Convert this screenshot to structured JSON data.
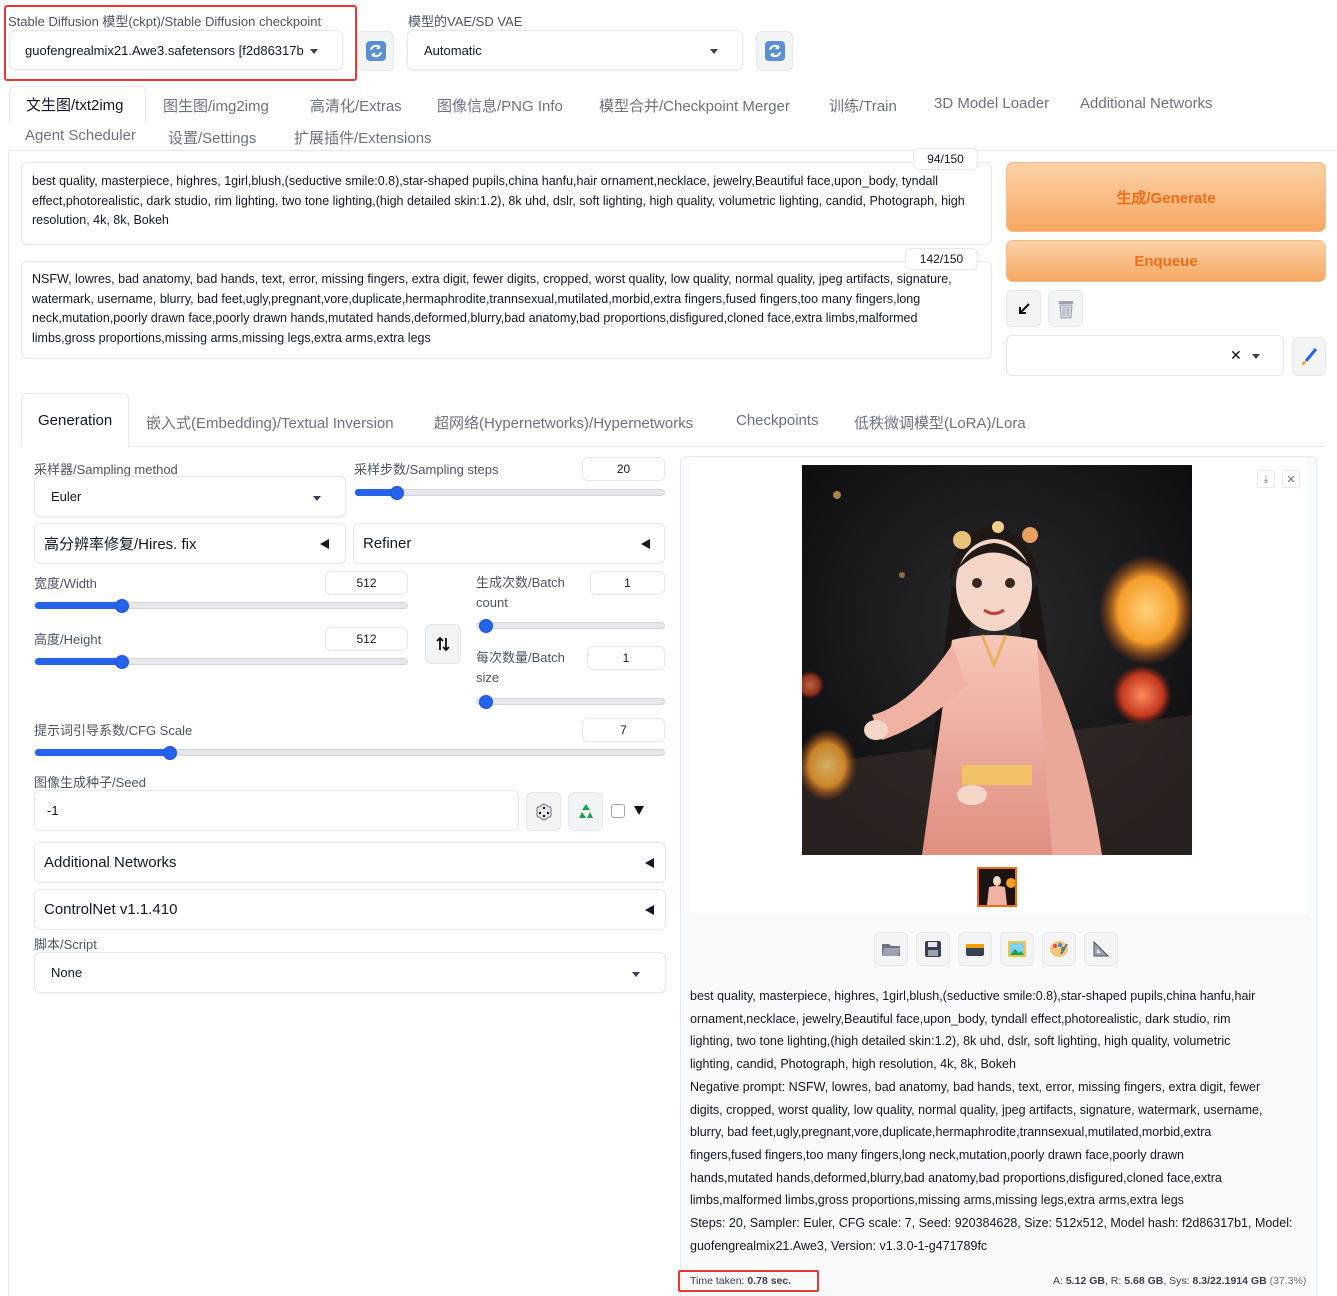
{
  "top": {
    "checkpoint_label": "Stable Diffusion 模型(ckpt)/Stable Diffusion checkpoint",
    "checkpoint_value": "guofengrealmix21.Awe3.safetensors [f2d86317b",
    "vae_label": "模型的VAE/SD VAE",
    "vae_value": "Automatic"
  },
  "tabs_main": [
    "文生图/txt2img",
    "图生图/img2img",
    "高清化/Extras",
    "图像信息/PNG Info",
    "模型合并/Checkpoint Merger",
    "训练/Train",
    "3D Model Loader",
    "Additional Networks",
    "Agent Scheduler",
    "设置/Settings",
    "扩展插件/Extensions"
  ],
  "prompt": {
    "text": "best quality, masterpiece, highres, 1girl,blush,(seductive smile:0.8),star-shaped pupils,china hanfu,hair ornament,necklace, jewelry,Beautiful face,upon_body, tyndall effect,photorealistic, dark studio, rim lighting, two tone lighting,(high detailed skin:1.2), 8k uhd, dslr, soft lighting, high quality, volumetric lighting, candid, Photograph, high resolution, 4k, 8k, Bokeh",
    "count": "94/150"
  },
  "negative": {
    "text": "NSFW, lowres, bad anatomy, bad hands, text, error, missing fingers, extra digit, fewer digits, cropped, worst quality, low quality, normal quality, jpeg artifacts, signature, watermark, username, blurry, bad feet,ugly,pregnant,vore,duplicate,hermaphrodite,trannsexual,mutilated,morbid,extra fingers,fused fingers,too many fingers,long neck,mutation,poorly drawn face,poorly drawn hands,mutated hands,deformed,blurry,bad anatomy,bad proportions,disfigured,cloned face,extra limbs,malformed limbs,gross proportions,missing arms,missing legs,extra arms,extra legs",
    "count": "142/150"
  },
  "actions": {
    "generate": "生成/Generate",
    "enqueue": "Enqueue"
  },
  "subtabs": [
    "Generation",
    "嵌入式(Embedding)/Textual Inversion",
    "超网络(Hypernetworks)/Hypernetworks",
    "Checkpoints",
    "低秩微调模型(LoRA)/Lora"
  ],
  "params": {
    "sampler_label": "采样器/Sampling method",
    "sampler_value": "Euler",
    "steps_label": "采样步数/Sampling steps",
    "steps_value": "20",
    "steps_fraction": 0.137,
    "hires_label": "高分辨率修复/Hires. fix",
    "refiner_label": "Refiner",
    "width_label": "宽度/Width",
    "width_value": "512",
    "width_fraction": 0.235,
    "height_label": "高度/Height",
    "height_value": "512",
    "height_fraction": 0.235,
    "batch_count_label_1": "生成次数/Batch",
    "batch_count_label_2": "count",
    "batch_count_value": "1",
    "batch_size_label_1": "每次数量/Batch",
    "batch_size_label_2": "size",
    "batch_size_value": "1",
    "cfg_label": "提示词引导系数/CFG Scale",
    "cfg_value": "7",
    "cfg_fraction": 0.214,
    "seed_label": "图像生成种子/Seed",
    "seed_value": "-1",
    "additional_networks": "Additional Networks",
    "controlnet": "ControlNet v1.1.410",
    "script_label": "脚本/Script",
    "script_value": "None"
  },
  "output": {
    "info_lines": [
      "best quality, masterpiece, highres, 1girl,blush,(seductive smile:0.8),star-shaped pupils,china hanfu,hair",
      "ornament,necklace, jewelry,Beautiful face,upon_body, tyndall effect,photorealistic, dark studio, rim",
      "lighting, two tone lighting,(high detailed skin:1.2), 8k uhd, dslr, soft lighting, high quality, volumetric",
      "lighting, candid, Photograph, high resolution, 4k, 8k, Bokeh",
      "Negative prompt: NSFW, lowres, bad anatomy, bad hands, text, error, missing fingers, extra digit, fewer",
      "digits, cropped, worst quality, low quality, normal quality, jpeg artifacts, signature, watermark, username,",
      "blurry, bad feet,ugly,pregnant,vore,duplicate,hermaphrodite,trannsexual,mutilated,morbid,extra",
      "fingers,fused fingers,too many fingers,long neck,mutation,poorly drawn face,poorly drawn",
      "hands,mutated hands,deformed,blurry,bad anatomy,bad proportions,disfigured,cloned face,extra",
      "limbs,malformed limbs,gross proportions,missing arms,missing legs,extra arms,extra legs",
      "Steps: 20, Sampler: Euler, CFG scale: 7, Seed: 920384628, Size: 512x512, Model hash: f2d86317b1, Model:",
      "guofengrealmix21.Awe3, Version: v1.3.0-1-g471789fc"
    ],
    "time_label": "Time taken: ",
    "time_value": "0.78 sec.",
    "vram_a_label": "A: ",
    "vram_a_value": "5.12 GB",
    "vram_r_label": ", R: ",
    "vram_r_value": "5.68 GB",
    "vram_sys_label": ", Sys: ",
    "vram_sys_value": "8.3/22.1914 GB",
    "vram_pct": " (37.3%)"
  },
  "colors": {
    "accent": "#ef6c1a",
    "highlight": "#e53935",
    "slider": "#2563eb"
  }
}
